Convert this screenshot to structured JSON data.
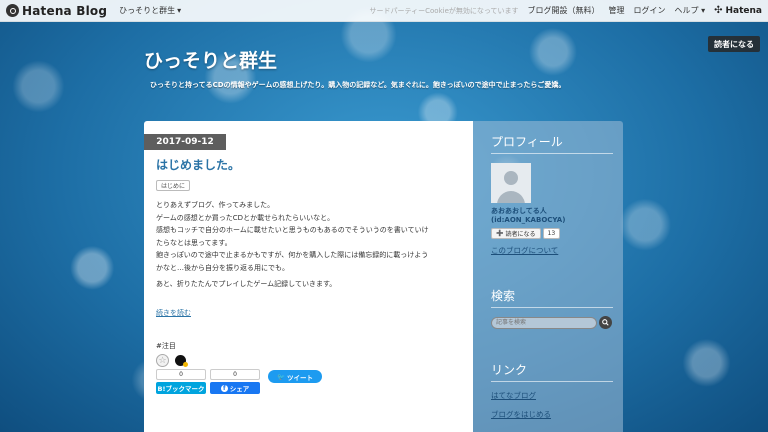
{
  "topbar": {
    "logo": "Hatena Blog",
    "blog_name": "ひっそりと群生",
    "blog_name_caret": "▾",
    "notice": "サードパーティーCookieが無効になっています",
    "links": [
      "ブログ開設（無料）",
      "管理",
      "ログイン",
      "ヘルプ ▾"
    ],
    "hatena": "Hatena"
  },
  "subscribe_top": "読者になる",
  "blog": {
    "title": "ひっそりと群生",
    "description": "ひっそりと持ってるCDの情報やゲームの感想上げたり。購入物の記録など。気まぐれに。飽きっぽいので途中で止まったらご愛嬌。"
  },
  "entry": {
    "date": "2017-09-12",
    "title": "はじめました。",
    "category": "はじめに",
    "paragraphs": [
      "とりあえずブログ、作ってみました。",
      "ゲームの感想とか買ったCDとか載せられたらいいなと。",
      "感想もコッチで自分のホームに載せたいと思うものもあるのでそういうのを書いていけ",
      "たらなとは思ってます。",
      "飽きっぽいので途中で止まるかもですが、何かを購入した際には備忘録的に載っけよう",
      "かなと…後から自分を振り返る用にでも。",
      "あと、折りたたんでプレイしたゲーム記録していきます。"
    ],
    "read_more": "続きを読む",
    "star_label": "#注目",
    "star_icon": "☆",
    "share": {
      "hatena_count": "0",
      "hatena_label": "B!ブックマーク",
      "facebook_count": "0",
      "facebook_label": "シェア",
      "facebook_icon": "f",
      "tweet_label": "ツイート",
      "tweet_icon": "🐦"
    }
  },
  "sidebar": {
    "profile_head": "プロフィール",
    "profile_name": "あおあおしてる人",
    "profile_id": "(id:AON_KABOCYA)",
    "subscribe_label": "読者になる",
    "subscribe_icon": "➕",
    "subscribe_count": "13",
    "about_link": "このブログについて",
    "search_head": "検索",
    "search_placeholder": "記事を検索",
    "search_icon": "🔍",
    "links_head": "リンク",
    "links": [
      "はてなブログ",
      "ブログをはじめる"
    ]
  },
  "colors": {
    "accent_link": "#2a73a6",
    "date_badge": "#5e5e5e",
    "hatena_blue": "#00a4de",
    "facebook_blue": "#1877f2",
    "twitter_blue": "#1d9bf0"
  }
}
